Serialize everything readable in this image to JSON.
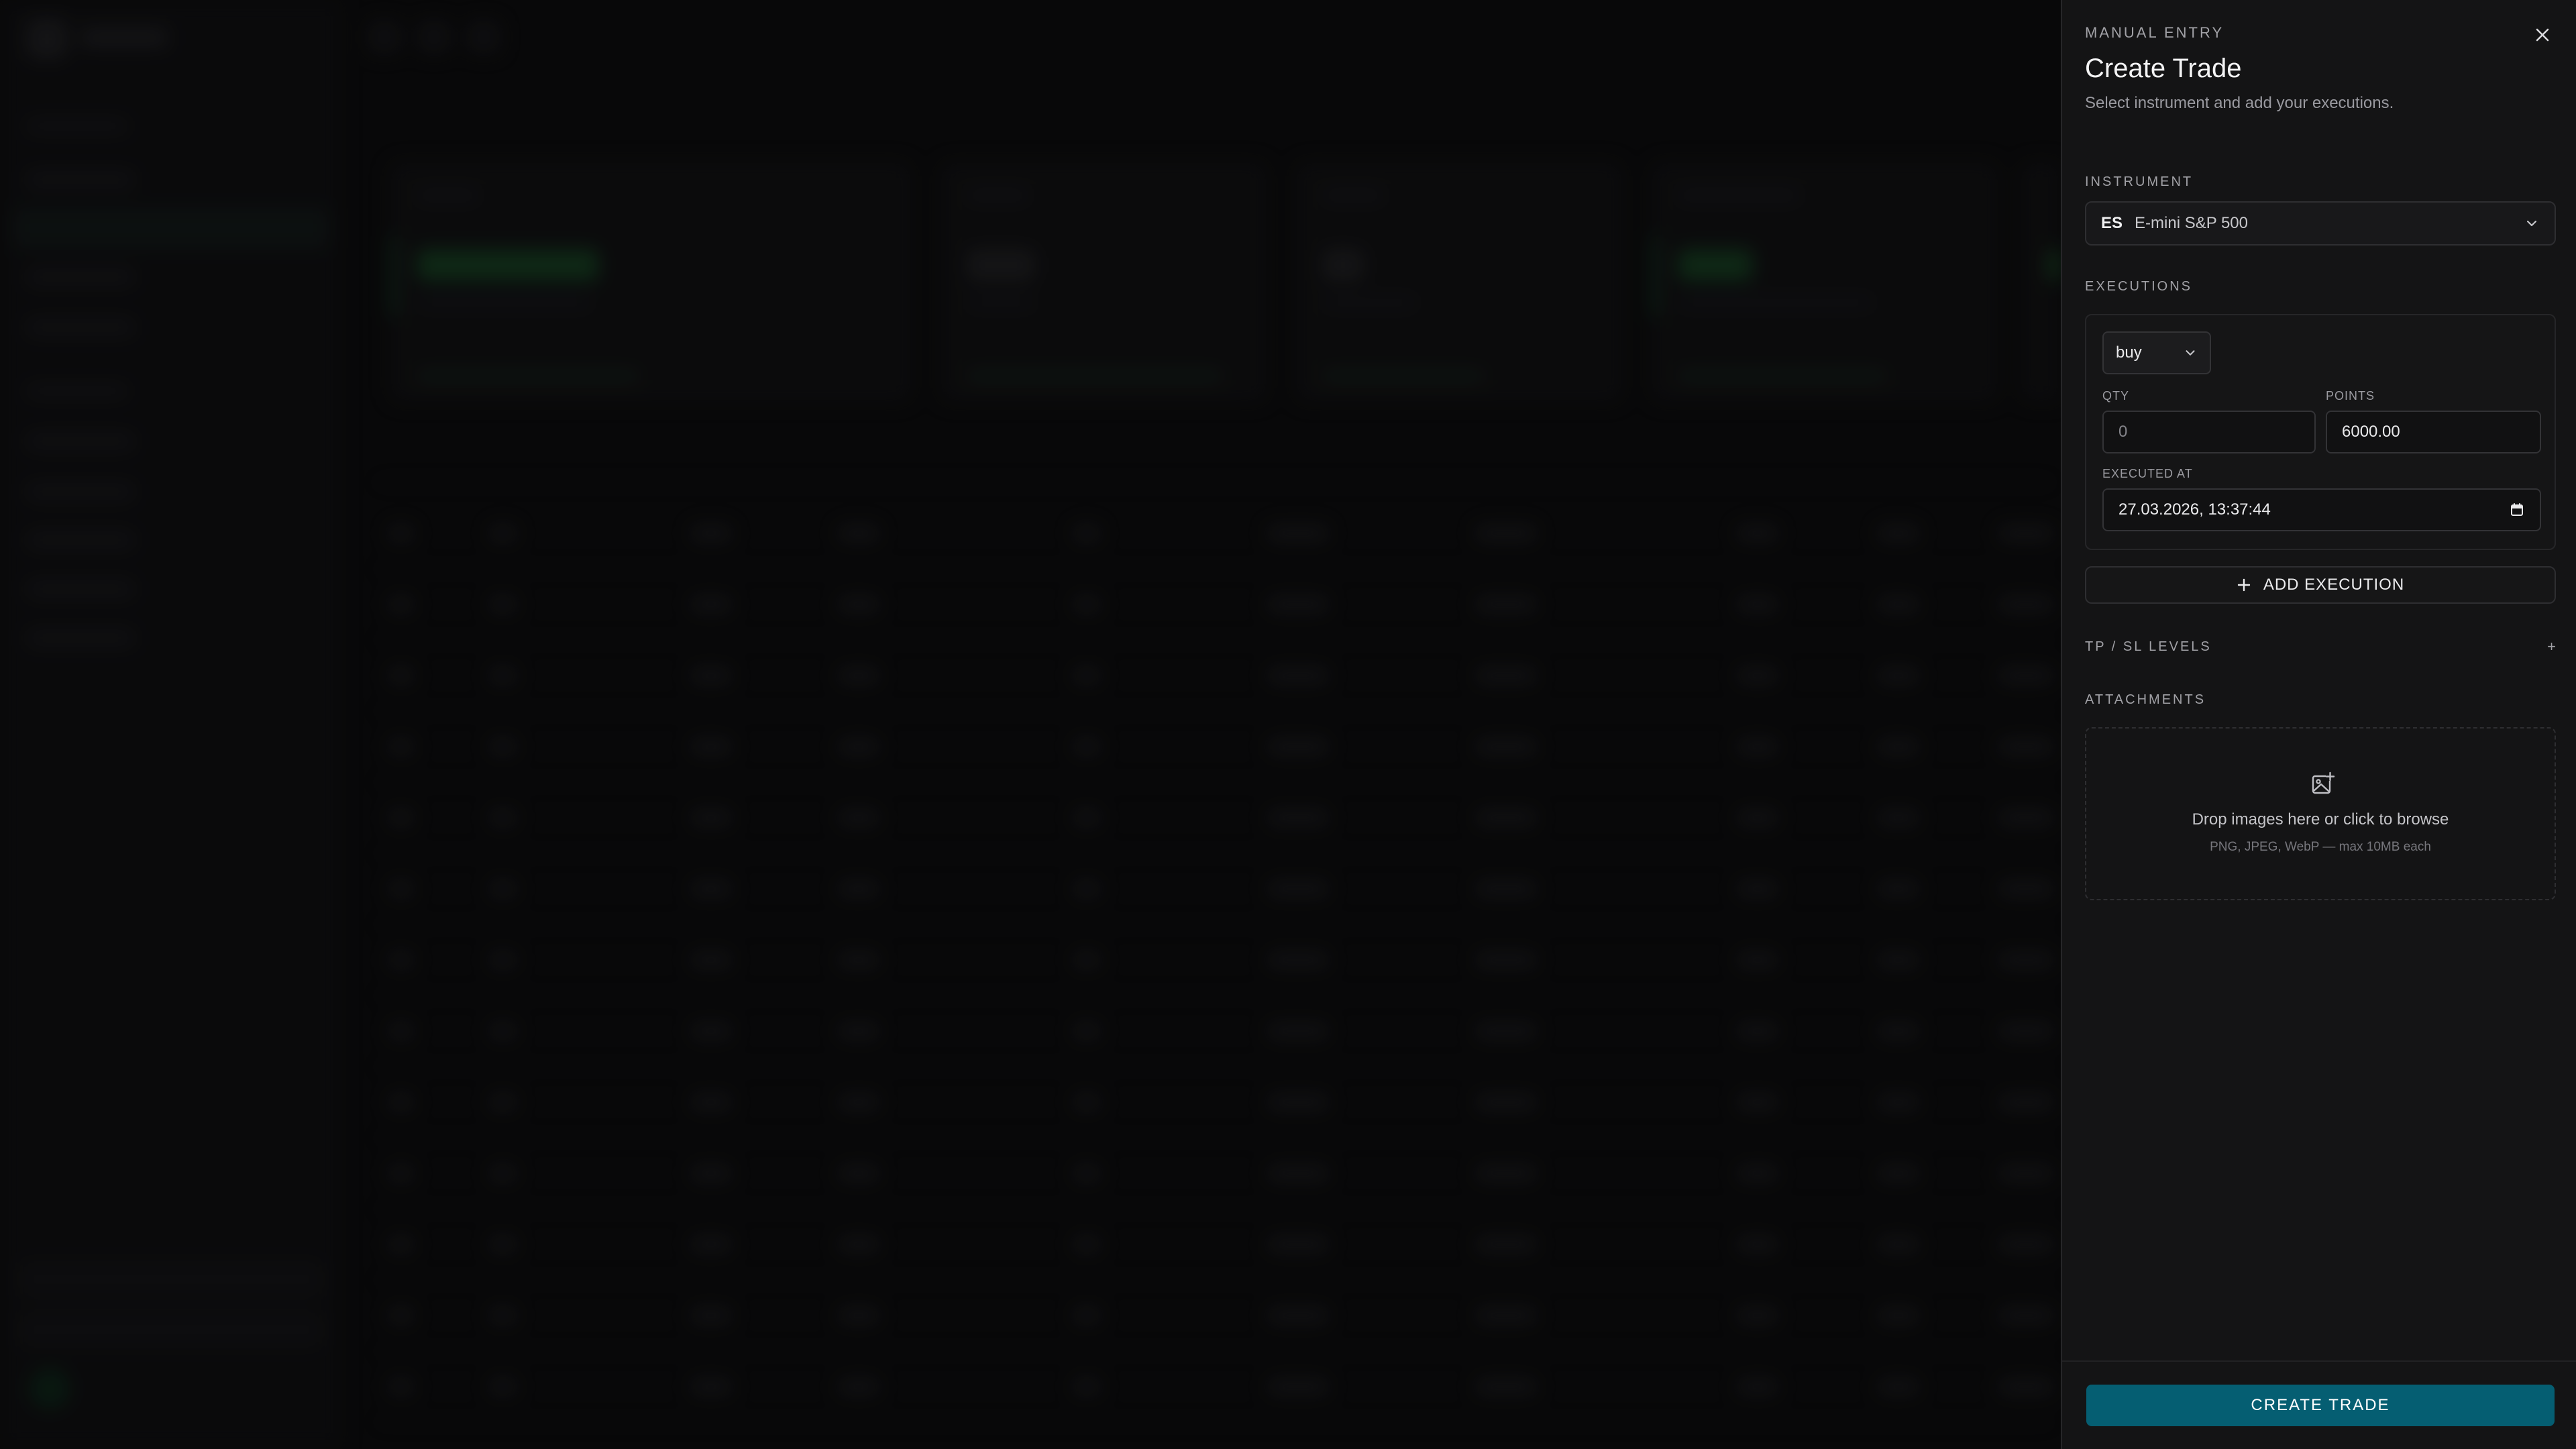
{
  "modal": {
    "eyebrow": "MANUAL ENTRY",
    "title": "Create Trade",
    "subtitle": "Select instrument and add your executions.",
    "close_icon": "close-icon"
  },
  "instrument": {
    "label": "INSTRUMENT",
    "code": "ES",
    "name": "E-mini S&P 500"
  },
  "executions": {
    "label": "EXECUTIONS",
    "side": "buy",
    "qty_label": "QTY",
    "qty_value": "0",
    "points_label": "POINTS",
    "points_value": "6000.00",
    "executed_at_label": "EXECUTED AT",
    "executed_at_value": "27.03.2026, 13:37:44",
    "add_label": "ADD EXECUTION"
  },
  "levels": {
    "label": "TP / SL LEVELS",
    "toggle": "+"
  },
  "attachments": {
    "label": "ATTACHMENTS",
    "drop_title": "Drop images here or click to browse",
    "drop_sub": "PNG, JPEG, WebP — max 10MB each"
  },
  "footer": {
    "create_label": "CREATE TRADE"
  },
  "colors": {
    "accent": "#055e72",
    "panel_bg": "#141415"
  }
}
